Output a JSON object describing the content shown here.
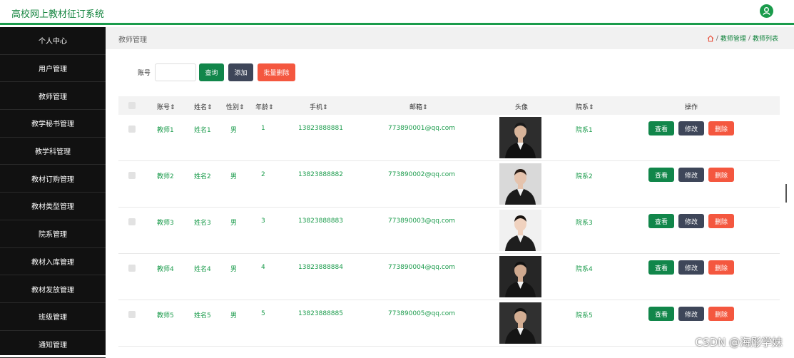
{
  "header": {
    "title": "高校网上教材征订系统",
    "user_icon": "user-circle-icon",
    "accent": "#1a9b4b"
  },
  "sidebar": {
    "items": [
      {
        "label": "个人中心"
      },
      {
        "label": "用户管理"
      },
      {
        "label": "教师管理"
      },
      {
        "label": "教学秘书管理"
      },
      {
        "label": "教学科管理"
      },
      {
        "label": "教材订购管理"
      },
      {
        "label": "教材类型管理"
      },
      {
        "label": "院系管理"
      },
      {
        "label": "教材入库管理"
      },
      {
        "label": "教材发放管理"
      },
      {
        "label": "班级管理"
      },
      {
        "label": "通知管理"
      }
    ]
  },
  "breadcrumb": {
    "title": "教师管理",
    "home_icon": "home-icon",
    "level1": "教师管理",
    "level2": "教师列表",
    "separator": "/"
  },
  "search": {
    "label": "账号",
    "value": "",
    "placeholder": "",
    "query_btn": "查询",
    "add_btn": "添加",
    "batch_delete_btn": "批量删除"
  },
  "table": {
    "headers": {
      "account": "账号",
      "name": "姓名",
      "gender": "性别",
      "age": "年龄",
      "phone": "手机",
      "email": "邮箱",
      "avatar": "头像",
      "department": "院系",
      "actions": "操作"
    },
    "sort_glyph": "⇕",
    "rows": [
      {
        "account": "教师1",
        "name": "姓名1",
        "gender": "男",
        "age": "1",
        "phone": "13823888881",
        "email": "773890001@qq.com",
        "department": "院系1"
      },
      {
        "account": "教师2",
        "name": "姓名2",
        "gender": "男",
        "age": "2",
        "phone": "13823888882",
        "email": "773890002@qq.com",
        "department": "院系2"
      },
      {
        "account": "教师3",
        "name": "姓名3",
        "gender": "男",
        "age": "3",
        "phone": "13823888883",
        "email": "773890003@qq.com",
        "department": "院系3"
      },
      {
        "account": "教师4",
        "name": "姓名4",
        "gender": "男",
        "age": "4",
        "phone": "13823888884",
        "email": "773890004@qq.com",
        "department": "院系4"
      },
      {
        "account": "教师5",
        "name": "姓名5",
        "gender": "男",
        "age": "5",
        "phone": "13823888885",
        "email": "773890005@qq.com",
        "department": "院系5"
      }
    ],
    "actions": {
      "view": "查看",
      "edit": "修改",
      "delete": "删除"
    }
  },
  "watermark": "CSDN @海彤学妹"
}
